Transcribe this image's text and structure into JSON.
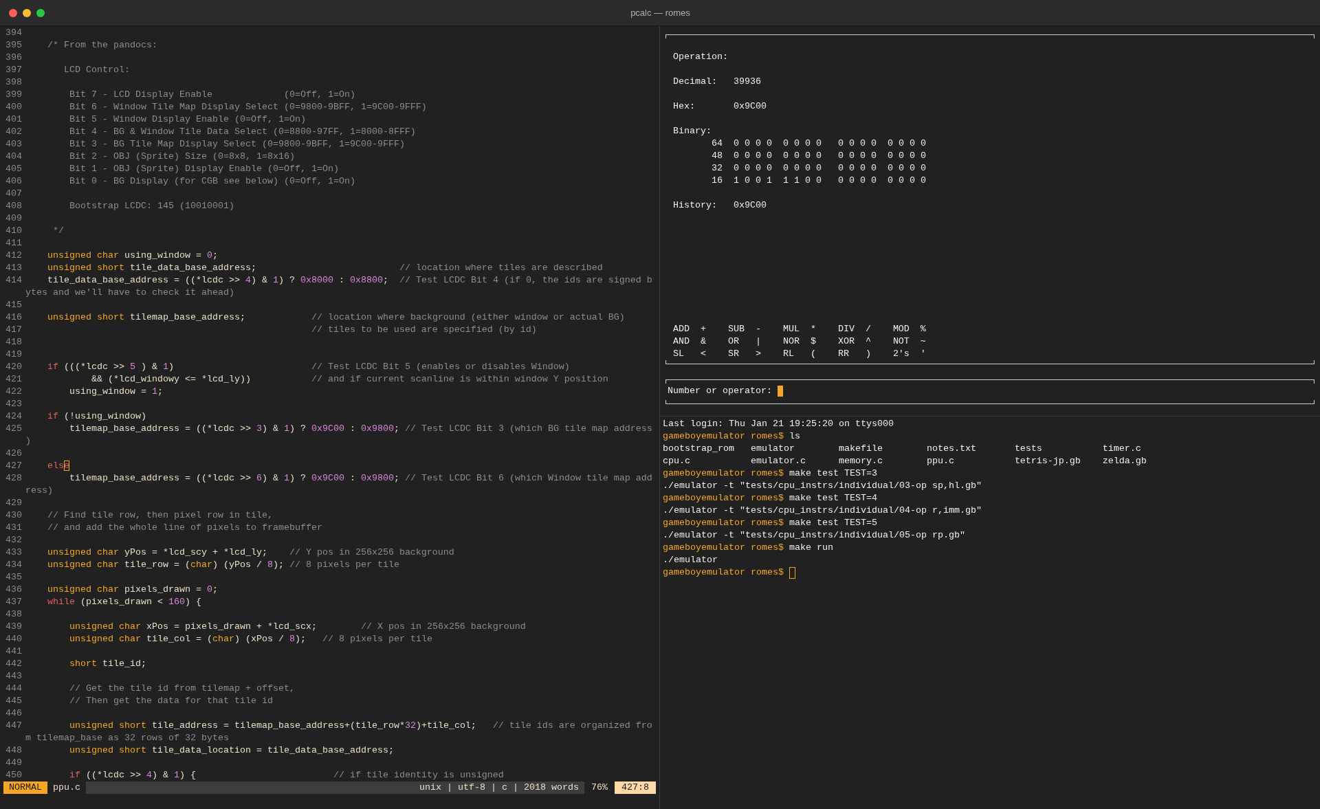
{
  "window": {
    "title": "pcalc — romes"
  },
  "editor": {
    "lines": [
      {
        "number": "394"
      },
      {
        "number": "395",
        "tokens": [
          {
            "kind": "comment",
            "text": "    /* From the pandocs:"
          }
        ]
      },
      {
        "number": "396"
      },
      {
        "number": "397",
        "tokens": [
          {
            "kind": "comment",
            "text": "       LCD Control:"
          }
        ]
      },
      {
        "number": "398"
      },
      {
        "number": "399",
        "tokens": [
          {
            "kind": "comment",
            "text": "        Bit 7 - LCD Display Enable             (0=Off, 1=On)"
          }
        ]
      },
      {
        "number": "400",
        "tokens": [
          {
            "kind": "comment",
            "text": "        Bit 6 - Window Tile Map Display Select (0=9800-9BFF, 1=9C00-9FFF)"
          }
        ]
      },
      {
        "number": "401",
        "tokens": [
          {
            "kind": "comment",
            "text": "        Bit 5 - Window Display Enable (0=Off, 1=On)"
          }
        ]
      },
      {
        "number": "402",
        "tokens": [
          {
            "kind": "comment",
            "text": "        Bit 4 - BG & Window Tile Data Select (0=8800-97FF, 1=8000-8FFF)"
          }
        ]
      },
      {
        "number": "403",
        "tokens": [
          {
            "kind": "comment",
            "text": "        Bit 3 - BG Tile Map Display Select (0=9800-9BFF, 1=9C00-9FFF)"
          }
        ]
      },
      {
        "number": "404",
        "tokens": [
          {
            "kind": "comment",
            "text": "        Bit 2 - OBJ (Sprite) Size (0=8x8, 1=8x16)"
          }
        ]
      },
      {
        "number": "405",
        "tokens": [
          {
            "kind": "comment",
            "text": "        Bit 1 - OBJ (Sprite) Display Enable (0=Off, 1=On)"
          }
        ]
      },
      {
        "number": "406",
        "tokens": [
          {
            "kind": "comment",
            "text": "        Bit 0 - BG Display (for CGB see below) (0=Off, 1=On)"
          }
        ]
      },
      {
        "number": "407"
      },
      {
        "number": "408",
        "tokens": [
          {
            "kind": "comment",
            "text": "        Bootstrap LCDC: 145 (10010001)"
          }
        ]
      },
      {
        "number": "409"
      },
      {
        "number": "410",
        "tokens": [
          {
            "kind": "comment",
            "text": "     */"
          }
        ]
      },
      {
        "number": "411"
      },
      {
        "number": "412",
        "tokens": [
          {
            "kind": "type",
            "text": "    unsigned char"
          },
          {
            "kind": "plain",
            "text": " using_window = "
          },
          {
            "kind": "number",
            "text": "0"
          },
          {
            "kind": "plain",
            "text": ";"
          }
        ]
      },
      {
        "number": "413",
        "tokens": [
          {
            "kind": "type",
            "text": "    unsigned short"
          },
          {
            "kind": "plain",
            "text": " tile_data_base_address;"
          },
          {
            "kind": "comment",
            "text": "                          // location where tiles are described"
          }
        ]
      },
      {
        "number": "414",
        "tokens": [
          {
            "kind": "plain",
            "text": "    tile_data_base_address = ((*lcdc >> "
          },
          {
            "kind": "number",
            "text": "4"
          },
          {
            "kind": "plain",
            "text": ") & "
          },
          {
            "kind": "number",
            "text": "1"
          },
          {
            "kind": "plain",
            "text": ") ? "
          },
          {
            "kind": "number",
            "text": "0x8000"
          },
          {
            "kind": "plain",
            "text": " : "
          },
          {
            "kind": "number",
            "text": "0x8800"
          },
          {
            "kind": "plain",
            "text": ";"
          },
          {
            "kind": "comment",
            "text": "  // Test LCDC Bit 4 (if 0, the ids are signed b"
          }
        ],
        "wrap": [
          {
            "kind": "comment",
            "text": "ytes and we'll have to check it ahead)"
          }
        ]
      },
      {
        "number": "415"
      },
      {
        "number": "416",
        "tokens": [
          {
            "kind": "type",
            "text": "    unsigned short"
          },
          {
            "kind": "plain",
            "text": " tilemap_base_address;"
          },
          {
            "kind": "comment",
            "text": "            // location where background (either window or actual BG)"
          }
        ]
      },
      {
        "number": "417",
        "tokens": [
          {
            "kind": "comment",
            "text": "                                                    // tiles to be used are specified (by id)"
          }
        ]
      },
      {
        "number": "418"
      },
      {
        "number": "419"
      },
      {
        "number": "420",
        "tokens": [
          {
            "kind": "keyword",
            "text": "    if"
          },
          {
            "kind": "plain",
            "text": " (((*lcdc >> "
          },
          {
            "kind": "number",
            "text": "5"
          },
          {
            "kind": "plain",
            "text": " ) & "
          },
          {
            "kind": "number",
            "text": "1"
          },
          {
            "kind": "plain",
            "text": ")"
          },
          {
            "kind": "comment",
            "text": "                         // Test LCDC Bit 5 (enables or disables Window)"
          }
        ]
      },
      {
        "number": "421",
        "tokens": [
          {
            "kind": "plain",
            "text": "            && (*lcd_windowy <= *lcd_ly))"
          },
          {
            "kind": "comment",
            "text": "           // and if current scanline is within window Y position"
          }
        ]
      },
      {
        "number": "422",
        "tokens": [
          {
            "kind": "plain",
            "text": "        using_window = "
          },
          {
            "kind": "number",
            "text": "1"
          },
          {
            "kind": "plain",
            "text": ";"
          }
        ]
      },
      {
        "number": "423"
      },
      {
        "number": "424",
        "tokens": [
          {
            "kind": "keyword",
            "text": "    if"
          },
          {
            "kind": "plain",
            "text": " (!using_window)"
          }
        ]
      },
      {
        "number": "425",
        "tokens": [
          {
            "kind": "plain",
            "text": "        tilemap_base_address = ((*lcdc >> "
          },
          {
            "kind": "number",
            "text": "3"
          },
          {
            "kind": "plain",
            "text": ") & "
          },
          {
            "kind": "number",
            "text": "1"
          },
          {
            "kind": "plain",
            "text": ") ? "
          },
          {
            "kind": "number",
            "text": "0x9C00"
          },
          {
            "kind": "plain",
            "text": " : "
          },
          {
            "kind": "number",
            "text": "0x9800"
          },
          {
            "kind": "plain",
            "text": ";"
          },
          {
            "kind": "comment",
            "text": " // Test LCDC Bit 3 (which BG tile map address"
          }
        ],
        "wrap": [
          {
            "kind": "comment",
            "text": ")"
          }
        ]
      },
      {
        "number": "426"
      },
      {
        "number": "427",
        "tokens": [
          {
            "kind": "keyword",
            "text": "    els"
          },
          {
            "kind": "cursor",
            "text": "e"
          }
        ]
      },
      {
        "number": "428",
        "tokens": [
          {
            "kind": "plain",
            "text": "        tilemap_base_address = ((*lcdc >> "
          },
          {
            "kind": "number",
            "text": "6"
          },
          {
            "kind": "plain",
            "text": ") & "
          },
          {
            "kind": "number",
            "text": "1"
          },
          {
            "kind": "plain",
            "text": ") ? "
          },
          {
            "kind": "number",
            "text": "0x9C00"
          },
          {
            "kind": "plain",
            "text": " : "
          },
          {
            "kind": "number",
            "text": "0x9800"
          },
          {
            "kind": "plain",
            "text": ";"
          },
          {
            "kind": "comment",
            "text": " // Test LCDC Bit 6 (which Window tile map add"
          }
        ],
        "wrap": [
          {
            "kind": "comment",
            "text": "ress)"
          }
        ]
      },
      {
        "number": "429"
      },
      {
        "number": "430",
        "tokens": [
          {
            "kind": "comment",
            "text": "    // Find tile row, then pixel row in tile,"
          }
        ]
      },
      {
        "number": "431",
        "tokens": [
          {
            "kind": "comment",
            "text": "    // and add the whole line of pixels to framebuffer"
          }
        ]
      },
      {
        "number": "432"
      },
      {
        "number": "433",
        "tokens": [
          {
            "kind": "type",
            "text": "    unsigned char"
          },
          {
            "kind": "plain",
            "text": " yPos = *lcd_scy + *lcd_ly;"
          },
          {
            "kind": "comment",
            "text": "    // Y pos in 256x256 background"
          }
        ]
      },
      {
        "number": "434",
        "tokens": [
          {
            "kind": "type",
            "text": "    unsigned char"
          },
          {
            "kind": "plain",
            "text": " tile_row = ("
          },
          {
            "kind": "type",
            "text": "char"
          },
          {
            "kind": "plain",
            "text": ") (yPos / "
          },
          {
            "kind": "number",
            "text": "8"
          },
          {
            "kind": "plain",
            "text": ");"
          },
          {
            "kind": "comment",
            "text": " // 8 pixels per tile"
          }
        ]
      },
      {
        "number": "435"
      },
      {
        "number": "436",
        "tokens": [
          {
            "kind": "type",
            "text": "    unsigned char"
          },
          {
            "kind": "plain",
            "text": " pixels_drawn = "
          },
          {
            "kind": "number",
            "text": "0"
          },
          {
            "kind": "plain",
            "text": ";"
          }
        ]
      },
      {
        "number": "437",
        "tokens": [
          {
            "kind": "keyword",
            "text": "    while"
          },
          {
            "kind": "plain",
            "text": " (pixels_drawn < "
          },
          {
            "kind": "number",
            "text": "160"
          },
          {
            "kind": "plain",
            "text": ") {"
          }
        ]
      },
      {
        "number": "438"
      },
      {
        "number": "439",
        "tokens": [
          {
            "kind": "type",
            "text": "        unsigned char"
          },
          {
            "kind": "plain",
            "text": " xPos = pixels_drawn + *lcd_scx;"
          },
          {
            "kind": "comment",
            "text": "        // X pos in 256x256 background"
          }
        ]
      },
      {
        "number": "440",
        "tokens": [
          {
            "kind": "type",
            "text": "        unsigned char"
          },
          {
            "kind": "plain",
            "text": " tile_col = ("
          },
          {
            "kind": "type",
            "text": "char"
          },
          {
            "kind": "plain",
            "text": ") (xPos / "
          },
          {
            "kind": "number",
            "text": "8"
          },
          {
            "kind": "plain",
            "text": ");"
          },
          {
            "kind": "comment",
            "text": "   // 8 pixels per tile"
          }
        ]
      },
      {
        "number": "441"
      },
      {
        "number": "442",
        "tokens": [
          {
            "kind": "type",
            "text": "        short"
          },
          {
            "kind": "plain",
            "text": " tile_id;"
          }
        ]
      },
      {
        "number": "443"
      },
      {
        "number": "444",
        "tokens": [
          {
            "kind": "comment",
            "text": "        // Get the tile id from tilemap + offset,"
          }
        ]
      },
      {
        "number": "445",
        "tokens": [
          {
            "kind": "comment",
            "text": "        // Then get the data for that tile id"
          }
        ]
      },
      {
        "number": "446"
      },
      {
        "number": "447",
        "tokens": [
          {
            "kind": "type",
            "text": "        unsigned short"
          },
          {
            "kind": "plain",
            "text": " tile_address = tilemap_base_address+(tile_row*"
          },
          {
            "kind": "number",
            "text": "32"
          },
          {
            "kind": "plain",
            "text": ")+tile_col;"
          },
          {
            "kind": "comment",
            "text": "   // tile ids are organized fro"
          }
        ],
        "wrap": [
          {
            "kind": "comment",
            "text": "m tilemap_base as 32 rows of 32 bytes"
          }
        ]
      },
      {
        "number": "448",
        "tokens": [
          {
            "kind": "type",
            "text": "        unsigned short"
          },
          {
            "kind": "plain",
            "text": " tile_data_location = tile_data_base_address;"
          }
        ]
      },
      {
        "number": "449"
      },
      {
        "number": "450",
        "tokens": [
          {
            "kind": "keyword",
            "text": "        if"
          },
          {
            "kind": "plain",
            "text": " ((*lcdc >> "
          },
          {
            "kind": "number",
            "text": "4"
          },
          {
            "kind": "plain",
            "text": ") & "
          },
          {
            "kind": "number",
            "text": "1"
          },
          {
            "kind": "plain",
            "text": ") {"
          },
          {
            "kind": "comment",
            "text": "                         // if tile identity is unsigned"
          }
        ]
      }
    ],
    "status_bar": {
      "mode": "NORMAL",
      "file": "ppu.c",
      "info": "unix | utf-8 | c | 2018 words",
      "percent": "76%",
      "position": "427:8"
    }
  },
  "calculator": {
    "fields": [
      {
        "label": "Operation:"
      },
      {
        "label": "Decimal:",
        "value": "39936"
      },
      {
        "label": "Hex:",
        "value": "0x9C00"
      }
    ],
    "binary": {
      "label": "Binary:",
      "rows": [
        {
          "row": "64",
          "bits": "0 0 0 0  0 0 0 0   0 0 0 0  0 0 0 0"
        },
        {
          "row": "48",
          "bits": "0 0 0 0  0 0 0 0   0 0 0 0  0 0 0 0"
        },
        {
          "row": "32",
          "bits": "0 0 0 0  0 0 0 0   0 0 0 0  0 0 0 0"
        },
        {
          "row": "16",
          "bits": "1 0 0 1  1 1 0 0   0 0 0 0  0 0 0 0"
        }
      ]
    },
    "history": {
      "label": "History:",
      "value": "0x9C00"
    },
    "operators": [
      [
        {
          "name": "ADD",
          "symbol": "+"
        },
        {
          "name": "SUB",
          "symbol": "-"
        },
        {
          "name": "MUL",
          "symbol": "*"
        },
        {
          "name": "DIV",
          "symbol": "/"
        },
        {
          "name": "MOD",
          "symbol": "%"
        }
      ],
      [
        {
          "name": "AND",
          "symbol": "&"
        },
        {
          "name": "OR",
          "symbol": "|"
        },
        {
          "name": "NOR",
          "symbol": "$"
        },
        {
          "name": "XOR",
          "symbol": "^"
        },
        {
          "name": "NOT",
          "symbol": "~"
        }
      ],
      [
        {
          "name": "SL",
          "symbol": "<"
        },
        {
          "name": "SR",
          "symbol": ">"
        },
        {
          "name": "RL",
          "symbol": "("
        },
        {
          "name": "RR",
          "symbol": ")"
        },
        {
          "name": "2's",
          "symbol": "'"
        }
      ]
    ],
    "input": {
      "label": "Number or operator:"
    }
  },
  "terminal": {
    "lines": [
      {
        "kind": "output",
        "text": "Last login: Thu Jan 21 19:25:20 on ttys000"
      },
      {
        "kind": "prompt",
        "prompt": "gameboyemulator romes$",
        "command": "ls"
      },
      {
        "kind": "files",
        "files": [
          "bootstrap_rom",
          "emulator",
          "makefile",
          "notes.txt",
          "tests",
          "timer.c",
          "cpu.c",
          "emulator.c",
          "memory.c",
          "ppu.c",
          "tetris-jp.gb",
          "zelda.gb"
        ]
      },
      {
        "kind": "prompt",
        "prompt": "gameboyemulator romes$",
        "command": "make test TEST=3"
      },
      {
        "kind": "output",
        "text": "./emulator -t \"tests/cpu_instrs/individual/03-op sp,hl.gb\""
      },
      {
        "kind": "prompt",
        "prompt": "gameboyemulator romes$",
        "command": "make test TEST=4"
      },
      {
        "kind": "output",
        "text": "./emulator -t \"tests/cpu_instrs/individual/04-op r,imm.gb\""
      },
      {
        "kind": "prompt",
        "prompt": "gameboyemulator romes$",
        "command": "make test TEST=5"
      },
      {
        "kind": "output",
        "text": "./emulator -t \"tests/cpu_instrs/individual/05-op rp.gb\""
      },
      {
        "kind": "prompt",
        "prompt": "gameboyemulator romes$",
        "command": "make run"
      },
      {
        "kind": "output",
        "text": "./emulator"
      },
      {
        "kind": "prompt",
        "prompt": "gameboyemulator romes$",
        "cursor": true
      }
    ]
  }
}
